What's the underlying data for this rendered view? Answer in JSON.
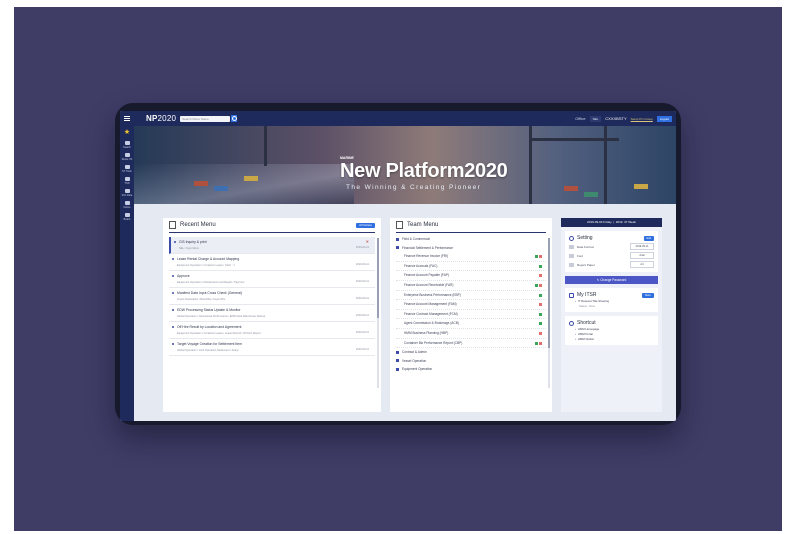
{
  "app": {
    "logo_bold": "NP",
    "logo_rest": "2020",
    "search_placeholder": "Search Menu Name",
    "office": "Office",
    "office_value": "SEL",
    "user": "CXXXBSTY",
    "user_link": "Setup Pin Group",
    "logout": "Logout"
  },
  "sidebar": [
    {
      "label": "Favorite",
      "icon": "star-icon"
    },
    {
      "label": "Search",
      "icon": "search-icon"
    },
    {
      "label": "Route XF",
      "icon": "route-icon"
    },
    {
      "label": "ST Tools",
      "icon": "tools-icon"
    },
    {
      "label": "TSD",
      "icon": "tsd-icon"
    },
    {
      "label": "Port Data",
      "icon": "download-icon"
    },
    {
      "label": "Notice",
      "icon": "notice-icon"
    },
    {
      "label": "Board",
      "icon": "board-icon"
    }
  ],
  "hero": {
    "subtitle": "MARINE",
    "title": "New Platform2020",
    "tagline": "The Winning & Creating Pioneer"
  },
  "recent": {
    "title": "Recent Menu",
    "button": "All Delete",
    "items": [
      {
        "title": "CIS Inquiry & print",
        "sub": "SEL / Input Menu",
        "date": "2019-09-11"
      },
      {
        "title": "Lease Rental Charge & Account Mapping",
        "sub": "Equipment Operation / Container Lease / Chart : 1",
        "date": "2019-09-11"
      },
      {
        "title": "Approve",
        "sub": "Equipment Operation / Maintenance and Repair / Payment",
        "date": "2019-09-11"
      },
      {
        "title": "Manifest Data Input Cross Check (General)",
        "sub": "Import Declaration / BAL/Ship / Import B/L",
        "date": "2019-09-11"
      },
      {
        "title": "EDW Processing Status Update & Monitor",
        "sub": "Global Operation / Operational Performance / EDW Data Warehouse Startup",
        "date": "2019-09-11"
      },
      {
        "title": "Off Hire Result by Location and Agreement",
        "sub": "Equipment Operation / Container Lease / Lease Record / Off Hire Report",
        "date": "2019-09-11"
      },
      {
        "title": "Target Voyage Creation for Settlement Item",
        "sub": "Global Operation / Joint Operation Settlement / Setup",
        "date": "2019-09-11"
      }
    ]
  },
  "team": {
    "title": "Team Menu",
    "items": [
      {
        "label": "Field & Commercial",
        "level": "group"
      },
      {
        "label": "Financial Settlement & Performance",
        "level": "group"
      },
      {
        "label": "Finance Revenue Invoice (FRI)",
        "level": "sub",
        "badges": [
          "#3aa55a",
          "#e07070"
        ]
      },
      {
        "label": "Finance Accruals (FAC)",
        "level": "sub",
        "badges": [
          "#3aa55a"
        ]
      },
      {
        "label": "Finance Account Payable (FAP)",
        "level": "sub",
        "badges": [
          "#e07070"
        ]
      },
      {
        "label": "Finance Account Receivable (FAR)",
        "level": "sub",
        "badges": [
          "#3aa55a",
          "#e07070"
        ]
      },
      {
        "label": "Enterprise Business Performance (EBP)",
        "level": "sub",
        "badges": [
          "#3aa55a"
        ]
      },
      {
        "label": "Finance Account Management (FAM)",
        "level": "sub",
        "badges": [
          "#e07070"
        ]
      },
      {
        "label": "Finance Contract Management (FCM)",
        "level": "sub",
        "badges": [
          "#3aa55a"
        ]
      },
      {
        "label": "Agent Commission & Brokerage (ACB)",
        "level": "sub",
        "badges": [
          "#3aa55a"
        ]
      },
      {
        "label": "HMM Business Planning (HBP)",
        "level": "sub",
        "badges": [
          "#e07070"
        ]
      },
      {
        "label": "Container Biz Performance Report (CBP)",
        "level": "sub",
        "badges": [
          "#3aa55a",
          "#e07070"
        ]
      },
      {
        "label": "Contract & Admin",
        "level": "group"
      },
      {
        "label": "Vessel Operation",
        "level": "group"
      },
      {
        "label": "Equipment Operation",
        "level": "group"
      }
    ]
  },
  "right": {
    "date": "2019-09-03 Friday",
    "week": "2019. 37 Week",
    "setting_title": "Setting",
    "setting_btn": "Edit",
    "rows": [
      {
        "label": "Date Format",
        "value": "2019-09-11"
      },
      {
        "label": "Font",
        "value": "Arial"
      },
      {
        "label": "Report Paper",
        "value": "A4"
      }
    ],
    "password_btn": "Change Password",
    "itsr_title": "My ITSR",
    "itsr_btn": "More",
    "itsr_items": [
      "IT Request Title Showing",
      "Status : New"
    ],
    "shortcut_title": "Shortcut",
    "shortcuts": [
      "HMM Homepage",
      "HMM Portal",
      "HMM Global"
    ]
  },
  "colors": {
    "stage": "#3f3d66",
    "nav": "#1e2a5b",
    "accent": "#2f6fe0",
    "purple_btn": "#4b57c5"
  }
}
